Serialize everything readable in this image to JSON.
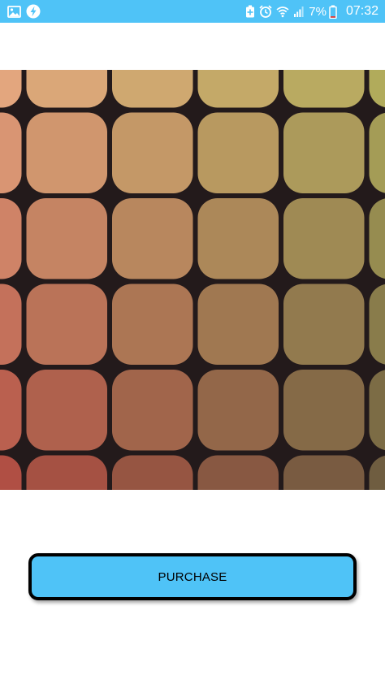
{
  "status_bar": {
    "left_icons": [
      "image-icon",
      "lightning-badge-icon"
    ],
    "right_icons": [
      "battery-saver-icon",
      "alarm-icon",
      "wifi-icon",
      "signal-icon",
      "battery-low-icon"
    ],
    "battery_percent": "7%",
    "time": "07:32",
    "background_color": "#4fc3f7"
  },
  "product": {
    "artwork": "rounded-tile-grid-gradient",
    "gradient_colors": [
      "#e3a67e",
      "#b1ab5b",
      "#b04f44",
      "#6f5d40"
    ],
    "grid_line_color": "#231a1b"
  },
  "purchase": {
    "label": "PURCHASE",
    "color": "#4fc3f7"
  }
}
